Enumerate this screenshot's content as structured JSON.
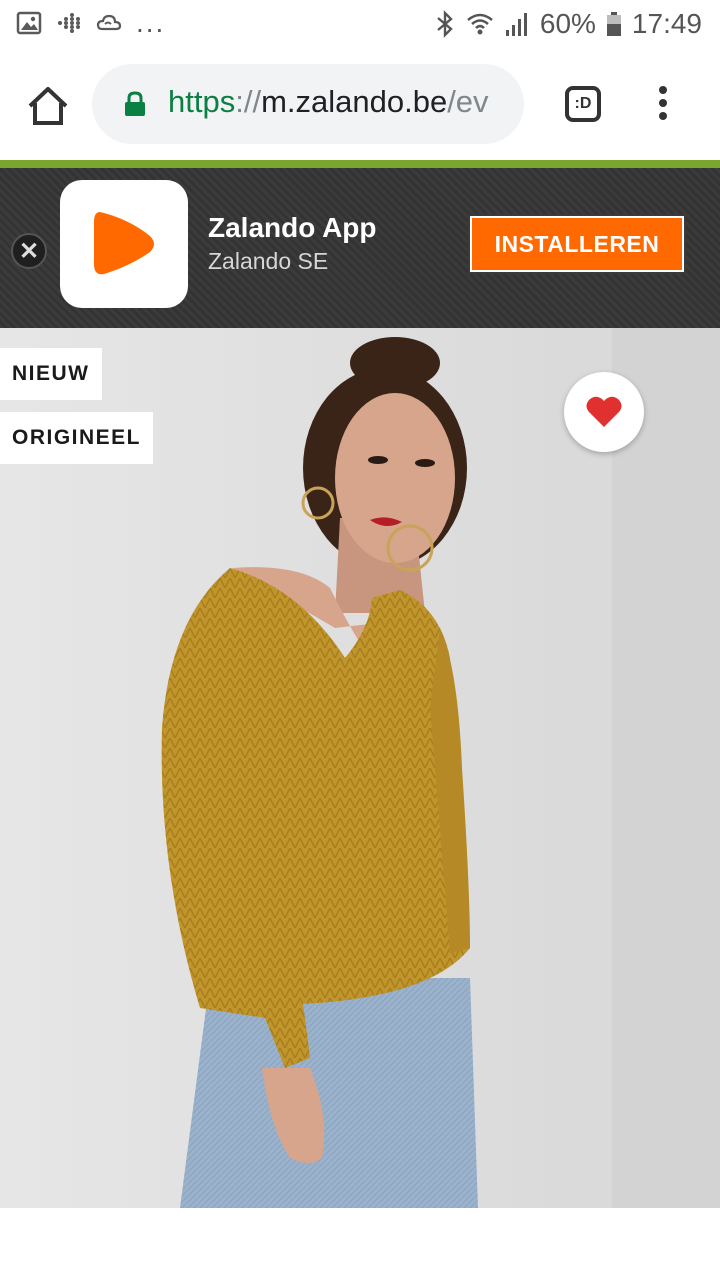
{
  "status_bar": {
    "battery": "60%",
    "time": "17:49",
    "left_overflow": "..."
  },
  "browser": {
    "url_scheme": "https",
    "url_separator": "://",
    "url_host": "m.zalando.be",
    "url_rest": "/ev",
    "tabs_label": ":D"
  },
  "app_banner": {
    "title": "Zalando App",
    "subtitle": "Zalando SE",
    "install_label": "INSTALLEREN",
    "accent": "#ff6900"
  },
  "product": {
    "badges": [
      "NIEUW",
      "ORIGINEEL"
    ],
    "favorite_icon": "heart-icon",
    "favorite_color": "#e03030"
  }
}
